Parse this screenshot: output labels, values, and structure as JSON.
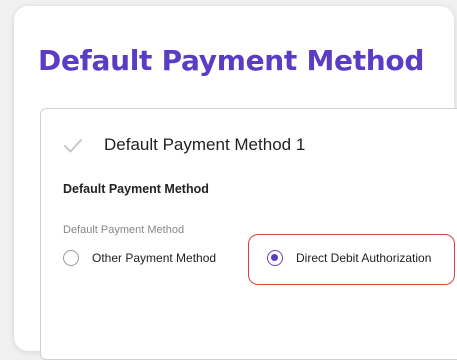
{
  "page": {
    "title": "Default Payment Method"
  },
  "section": {
    "heading": "Default Payment Method 1",
    "subheading": "Default Payment Method",
    "field_label": "Default Payment Method"
  },
  "payment_options": [
    {
      "label": "Other Payment Method",
      "selected": false
    },
    {
      "label": "Direct Debit Authorization",
      "selected": true
    }
  ],
  "colors": {
    "title": "#5b3cc4",
    "radio_selected": "#5b3cc4",
    "highlight_border": "#d9433c"
  },
  "icons": {
    "section_status": "check-icon"
  }
}
